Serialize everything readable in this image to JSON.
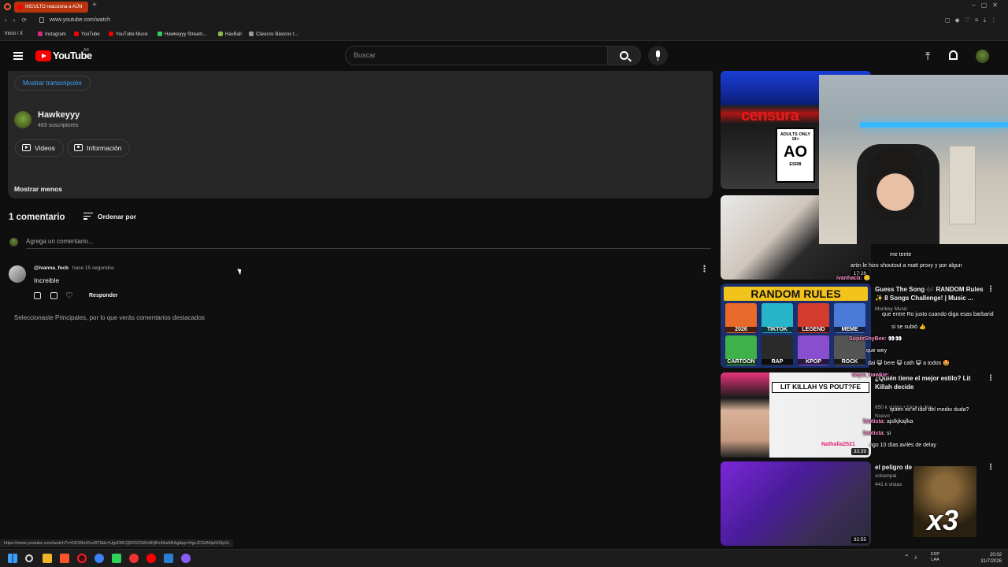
{
  "browser": {
    "tab_title": "INCULTO reacciona a AÜN",
    "new_tab": "+",
    "url": "www.youtube.com/watch",
    "bookmarks": [
      "Inicio / X",
      "Instagram",
      "YouTube",
      "YouTube Music",
      "Hawkeyyy Stream...",
      "HaxBall",
      "Clásicos Básicos t..."
    ],
    "status_url": "https://www.youtube.com/watch?v=DK9SmDcxRTI&lc=UgzD8CQDfZZGWn5KjRx4AaABAg&pp=0gcJCSIANpG00pGi"
  },
  "header": {
    "logo_text": "YouTube",
    "country": "AR",
    "search_placeholder": "Buscar"
  },
  "description": {
    "transcript_button": "Mostrar transcripción",
    "channel_name": "Hawkeyyy",
    "channel_subs": "463 suscriptores",
    "videos_button": "Videos",
    "info_button": "Información",
    "show_less": "Mostrar menos"
  },
  "comments": {
    "count_label": "1 comentario",
    "sort_label": "Ordenar por",
    "add_placeholder": "Agrega un comentario...",
    "items": [
      {
        "author": "@ivanna_fecb",
        "time": "hace 15 segundos",
        "text": "Increible",
        "reply": "Responder"
      }
    ],
    "info": "Seleccionaste Principales, por lo que verás comentarios destacados"
  },
  "sidebar": {
    "items": [
      {
        "thumb_text": "censura",
        "esrb_top": "ADULTS ONLY 18+",
        "esrb_mid": "AO",
        "esrb_bottom": "ESRB"
      },
      {
        "duration": "17:28"
      },
      {
        "thumb_title": "RANDOM RULES",
        "cells": [
          "2026",
          "TIKTOK",
          "LEGEND",
          "MEME",
          "CARTOON",
          "RAP",
          "KPOP",
          "ROCK"
        ],
        "title": "Guess The Song 🎶 RANDOM Rules ✨ 8 Songs Challenge! | Music ...",
        "channel": "Monkey Music"
      },
      {
        "duration": "33:39",
        "banner": "LIT KILLAH VS POUT?FE",
        "name_text": "Nathalia2521",
        "title": "¿Quién tiene el mejor estilo? Lit Killah decide",
        "meta": "850 k vistas • hace 4 días",
        "badge": "Nuevo"
      },
      {
        "duration": "32:55",
        "title": "el peligro de",
        "channel": "solsenpai",
        "meta": "441 k vistas"
      }
    ]
  },
  "chat": {
    "lines": [
      {
        "user": "",
        "text": "me tente"
      },
      {
        "user": "",
        "text": "artin le hizo shoutout a matt proxy y por algun"
      },
      {
        "user": "ivanhacb:",
        "text": "🙂"
      },
      {
        "user": "",
        "text": "que entre Ro justo cuando diga esas barbarid"
      },
      {
        "user": "",
        "text": "si se subió 👍"
      },
      {
        "user": "SuperShyBee:",
        "text": "👀👀"
      },
      {
        "user": "",
        "text": "que wey"
      },
      {
        "user": "",
        "text": "dai 😺 bere 😺 cath 😺 a todos 🤩"
      },
      {
        "user": "keysi_hawkie:",
        "text": ""
      },
      {
        "user": "",
        "text": "quien es el idol del medio duda?"
      },
      {
        "user": "lawtista:",
        "text": "ajslkjkajlka"
      },
      {
        "user": "lawtista:",
        "text": "si"
      },
      {
        "user": "",
        "text": "ngo 10 días avilés de delay"
      }
    ],
    "overlay_text": "x3"
  },
  "taskbar": {
    "lang_top": "ESP",
    "lang_bottom": "LAA",
    "time": "20:02",
    "date": "31/7/2026"
  }
}
